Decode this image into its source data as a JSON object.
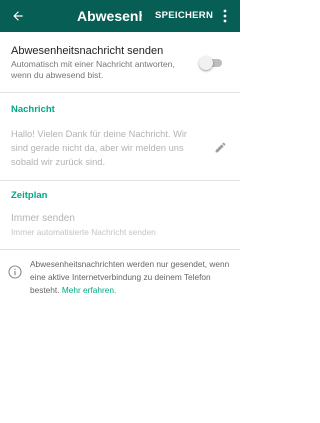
{
  "appbar": {
    "title": "Abwesenheitsnachricht",
    "save_label": "SPEICHERN",
    "back_icon": "arrow-back-icon",
    "menu_icon": "more-vert-icon",
    "color": "#075e54"
  },
  "away": {
    "title": "Abwesenheitsnachricht senden",
    "subtitle": "Automatisch mit einer Nachricht antworten, wenn du abwesend bist.",
    "enabled": false
  },
  "message_section": {
    "header": "Nachricht",
    "text": "Hallo! Vielen Dank für deine Nachricht. Wir sind gerade nicht da, aber wir melden uns sobald wir zurück sind.",
    "edit_icon": "pencil-icon"
  },
  "schedule_section": {
    "header": "Zeitplan",
    "title": "Immer senden",
    "subtitle": "Immer automatisierte Nachricht senden"
  },
  "info": {
    "icon": "info-icon",
    "text": "Abwesenheitsnachrichten werden nur gesendet, wenn eine aktive Internetverbindung zu deinem Telefon besteht.",
    "link": "Mehr erfahren."
  },
  "colors": {
    "accent": "#00a884"
  }
}
